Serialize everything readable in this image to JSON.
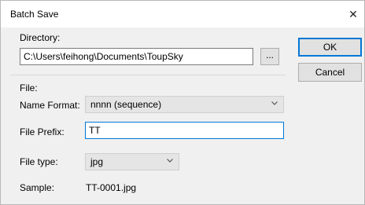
{
  "window": {
    "title": "Batch Save",
    "close_glyph": "✕"
  },
  "directory": {
    "label": "Directory:",
    "value": "C:\\Users\\feihong\\Documents\\ToupSky",
    "browse_label": "..."
  },
  "file": {
    "section_label": "File:",
    "name_format_label": "Name Format:",
    "name_format_value": "nnnn (sequence)",
    "file_prefix_label": "File Prefix:",
    "file_prefix_value": "TT",
    "file_type_label": "File type:",
    "file_type_value": "jpg",
    "sample_label": "Sample:",
    "sample_value": "TT-0001.jpg"
  },
  "buttons": {
    "ok": "OK",
    "cancel": "Cancel"
  },
  "icons": {
    "close": "close-icon",
    "dropdown": "chevron-down-icon"
  }
}
